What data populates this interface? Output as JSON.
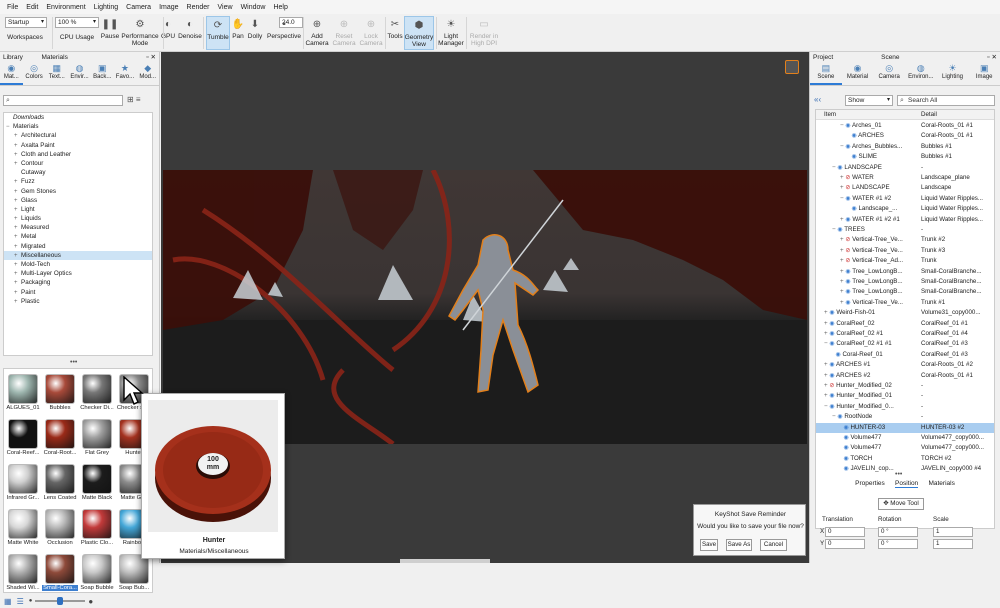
{
  "menu": [
    "File",
    "Edit",
    "Environment",
    "Lighting",
    "Camera",
    "Image",
    "Render",
    "View",
    "Window",
    "Help"
  ],
  "toolbar": {
    "workspace_select": "Startup",
    "zoom_select": "100 %",
    "fov_value": "24.0",
    "buttons": [
      {
        "id": "workspaces",
        "label": "Workspaces",
        "icon": "workspaces-icon"
      },
      {
        "id": "cpu",
        "label": "CPU Usage",
        "icon": "cpu-icon"
      },
      {
        "id": "pause",
        "label": "Pause",
        "icon": "pause-icon"
      },
      {
        "id": "perf",
        "label": "Performance Mode",
        "icon": "performance-icon"
      },
      {
        "id": "gpu",
        "label": "GPU",
        "icon": "gpu-icon"
      },
      {
        "id": "denoise",
        "label": "Denoise",
        "icon": "denoise-icon"
      },
      {
        "id": "tumble",
        "label": "Tumble",
        "icon": "tumble-icon"
      },
      {
        "id": "pan",
        "label": "Pan",
        "icon": "pan-icon"
      },
      {
        "id": "dolly",
        "label": "Dolly",
        "icon": "dolly-icon"
      },
      {
        "id": "perspective",
        "label": "Perspective",
        "icon": "perspective-icon"
      },
      {
        "id": "addcamera",
        "label": "Add Camera",
        "icon": "add-camera-icon"
      },
      {
        "id": "resetcamera",
        "label": "Reset Camera",
        "icon": "reset-camera-icon"
      },
      {
        "id": "lockcamera",
        "label": "Lock Camera",
        "icon": "lock-camera-icon"
      },
      {
        "id": "tools",
        "label": "Tools",
        "icon": "tools-icon"
      },
      {
        "id": "geometry",
        "label": "Geometry View",
        "icon": "geometry-view-icon"
      },
      {
        "id": "lightmgr",
        "label": "Light Manager",
        "icon": "light-manager-icon"
      },
      {
        "id": "hidpi",
        "label": "Render in High DPI",
        "icon": "high-dpi-icon"
      }
    ]
  },
  "library": {
    "header_left": "Library",
    "header_title": "Materials",
    "tabs": [
      "Mat...",
      "Colors",
      "Text...",
      "Envir...",
      "Back...",
      "Favo...",
      "Mod..."
    ],
    "search_placeholder": "",
    "tree": [
      {
        "label": "Downloads",
        "expander": "",
        "italic": true
      },
      {
        "label": "Materials",
        "expander": "−"
      },
      {
        "label": "Architectural",
        "expander": "+"
      },
      {
        "label": "Axalta Paint",
        "expander": "+"
      },
      {
        "label": "Cloth and Leather",
        "expander": "+"
      },
      {
        "label": "Contour",
        "expander": "+"
      },
      {
        "label": "Cutaway",
        "expander": ""
      },
      {
        "label": "Fuzz",
        "expander": "+"
      },
      {
        "label": "Gem Stones",
        "expander": "+"
      },
      {
        "label": "Glass",
        "expander": "+"
      },
      {
        "label": "Light",
        "expander": "+"
      },
      {
        "label": "Liquids",
        "expander": "+"
      },
      {
        "label": "Measured",
        "expander": "+"
      },
      {
        "label": "Metal",
        "expander": "+"
      },
      {
        "label": "Migrated",
        "expander": "+"
      },
      {
        "label": "Miscellaneous",
        "expander": "+",
        "selected": true
      },
      {
        "label": "Mold-Tech",
        "expander": "+"
      },
      {
        "label": "Multi-Layer Optics",
        "expander": "+"
      },
      {
        "label": "Packaging",
        "expander": "+"
      },
      {
        "label": "Paint",
        "expander": "+"
      },
      {
        "label": "Plastic",
        "expander": "+"
      }
    ],
    "thumbs": [
      {
        "label": "ALGUES_01",
        "color": "#9fb7b0"
      },
      {
        "label": "Bubbles",
        "color": "#a84a3a"
      },
      {
        "label": "Checker Di...",
        "color": "#777"
      },
      {
        "label": "Checker sh...",
        "color": "#888"
      },
      {
        "label": "Coral-Reef...",
        "color": "#111"
      },
      {
        "label": "Coral-Root...",
        "color": "#9a2a18"
      },
      {
        "label": "Flat Grey",
        "color": "#a0a0a0"
      },
      {
        "label": "Hunter",
        "color": "#a43220"
      },
      {
        "label": "Infrared Gr...",
        "color": "#cfcfcf"
      },
      {
        "label": "Lens Coated",
        "color": "#666"
      },
      {
        "label": "Matte Black",
        "color": "#1c1c1c"
      },
      {
        "label": "Matte Gr...",
        "color": "#8c8c8c"
      },
      {
        "label": "Matte White",
        "color": "#d8d8d8"
      },
      {
        "label": "Occlusion",
        "color": "#b9b9b9"
      },
      {
        "label": "Plastic Clo...",
        "color": "#c23a3a"
      },
      {
        "label": "Rainbow",
        "color": "#44a7d8"
      },
      {
        "label": "Shaded Wi...",
        "color": "#b0b0b0"
      },
      {
        "label": "Small-Cora...",
        "color": "#8e4a3a",
        "selected": true
      },
      {
        "label": "Soap Bubble",
        "color": "#c8c8c8"
      },
      {
        "label": "Soap Bub...",
        "color": "#bfbfbf"
      }
    ]
  },
  "preview": {
    "title": "Hunter",
    "path": "Materials/Miscellaneous",
    "badge_value": "100",
    "badge_unit": "mm"
  },
  "reminder": {
    "title": "KeyShot Save Reminder",
    "message": "Would you like to save your file now?",
    "save": "Save",
    "save_as": "Save As",
    "cancel": "Cancel"
  },
  "project": {
    "header_left": "Project",
    "header_title": "Scene",
    "tabs": [
      "Scene",
      "Material",
      "Camera",
      "Environ...",
      "Lighting",
      "Image"
    ],
    "show_select": "Show",
    "search_placeholder": "Search All",
    "col_item": "Item",
    "col_detail": "Detail",
    "rows": [
      {
        "indent": 3,
        "exp": "−",
        "vis": "on",
        "name": "Arches_01",
        "detail": "Coral-Roots_01 #1"
      },
      {
        "indent": 4,
        "exp": "",
        "vis": "on",
        "name": "ARCHES",
        "detail": "Coral-Roots_01 #1"
      },
      {
        "indent": 3,
        "exp": "−",
        "vis": "on",
        "name": "Arches_Bubbles...",
        "detail": "Bubbles #1"
      },
      {
        "indent": 4,
        "exp": "",
        "vis": "on",
        "name": "SLIME",
        "detail": "Bubbles #1"
      },
      {
        "indent": 2,
        "exp": "−",
        "vis": "on",
        "name": "LANDSCAPE",
        "detail": "-"
      },
      {
        "indent": 3,
        "exp": "+",
        "vis": "off",
        "name": "WATER",
        "detail": "Landscape_plane"
      },
      {
        "indent": 3,
        "exp": "+",
        "vis": "off",
        "name": "LANDSCAPE",
        "detail": "Landscape"
      },
      {
        "indent": 3,
        "exp": "−",
        "vis": "on",
        "name": "WATER #1 #2",
        "detail": "Liquid Water Ripples..."
      },
      {
        "indent": 4,
        "exp": "",
        "vis": "on",
        "name": "Landscape_...",
        "detail": "Liquid Water Ripples..."
      },
      {
        "indent": 3,
        "exp": "+",
        "vis": "on",
        "name": "WATER #1 #2 #1",
        "detail": "Liquid Water Ripples..."
      },
      {
        "indent": 2,
        "exp": "−",
        "vis": "on",
        "name": "TREES",
        "detail": "-"
      },
      {
        "indent": 3,
        "exp": "+",
        "vis": "off",
        "name": "Vertical-Tree_Ve...",
        "detail": "Trunk #2"
      },
      {
        "indent": 3,
        "exp": "+",
        "vis": "off",
        "name": "Vertical-Tree_Ve...",
        "detail": "Trunk #3"
      },
      {
        "indent": 3,
        "exp": "+",
        "vis": "off",
        "name": "Vertical-Tree_Ad...",
        "detail": "Trunk"
      },
      {
        "indent": 3,
        "exp": "+",
        "vis": "on",
        "name": "Tree_LowLongB...",
        "detail": "Small-CoralBranche..."
      },
      {
        "indent": 3,
        "exp": "+",
        "vis": "on",
        "name": "Tree_LowLongB...",
        "detail": "Small-CoralBranche..."
      },
      {
        "indent": 3,
        "exp": "+",
        "vis": "on",
        "name": "Tree_LowLongB...",
        "detail": "Small-CoralBranche..."
      },
      {
        "indent": 3,
        "exp": "+",
        "vis": "on",
        "name": "Vertical-Tree_Ve...",
        "detail": "Trunk #1"
      },
      {
        "indent": 1,
        "exp": "+",
        "vis": "on",
        "name": "Weird-Fish-01",
        "detail": "Volume31_copy000..."
      },
      {
        "indent": 1,
        "exp": "+",
        "vis": "on",
        "name": "CoralReef_02",
        "detail": "CoralReef_01 #1"
      },
      {
        "indent": 1,
        "exp": "+",
        "vis": "on",
        "name": "CoralReef_02 #1",
        "detail": "CoralReef_01 #4"
      },
      {
        "indent": 1,
        "exp": "−",
        "vis": "on",
        "name": "CoralReef_02 #1 #1",
        "detail": "CoralReef_01 #3"
      },
      {
        "indent": 2,
        "exp": "",
        "vis": "on",
        "name": "Coral-Reef_01",
        "detail": "CoralReef_01 #3"
      },
      {
        "indent": 1,
        "exp": "+",
        "vis": "on",
        "name": "ARCHES #1",
        "detail": "Coral-Roots_01 #2"
      },
      {
        "indent": 1,
        "exp": "+",
        "vis": "on",
        "name": "ARCHES #2",
        "detail": "Coral-Roots_01 #1"
      },
      {
        "indent": 1,
        "exp": "+",
        "vis": "off",
        "name": "Hunter_Modified_02",
        "detail": "-"
      },
      {
        "indent": 1,
        "exp": "+",
        "vis": "on",
        "name": "Hunter_Modified_01",
        "detail": "-"
      },
      {
        "indent": 1,
        "exp": "−",
        "vis": "on",
        "name": "Hunter_Modified_0...",
        "detail": "-"
      },
      {
        "indent": 2,
        "exp": "−",
        "vis": "on",
        "name": "RootNode",
        "detail": "-"
      },
      {
        "indent": 3,
        "exp": "",
        "vis": "on",
        "name": "HUNTER-03",
        "detail": "HUNTER-03 #2",
        "selected": true
      },
      {
        "indent": 3,
        "exp": "",
        "vis": "on",
        "name": "Volume477",
        "detail": "Volume477_copy000..."
      },
      {
        "indent": 3,
        "exp": "",
        "vis": "on",
        "name": "Volume477",
        "detail": "Volume477_copy000..."
      },
      {
        "indent": 3,
        "exp": "",
        "vis": "on",
        "name": "TORCH",
        "detail": "TORCH #2"
      },
      {
        "indent": 3,
        "exp": "",
        "vis": "on",
        "name": "JAVELIN_cop...",
        "detail": "JAVELIN_copy000 #4"
      }
    ],
    "bottom_tabs": [
      "Properties",
      "Position",
      "Materials"
    ],
    "move_tool": "Move Tool",
    "translation_label": "Translation",
    "rotation_label": "Rotation",
    "scale_label": "Scale",
    "x_label": "X",
    "y_label": "Y",
    "tx": "0",
    "ty": "0",
    "rx": "0 °",
    "ry": "0 °",
    "sx": "1",
    "sy": "1"
  }
}
